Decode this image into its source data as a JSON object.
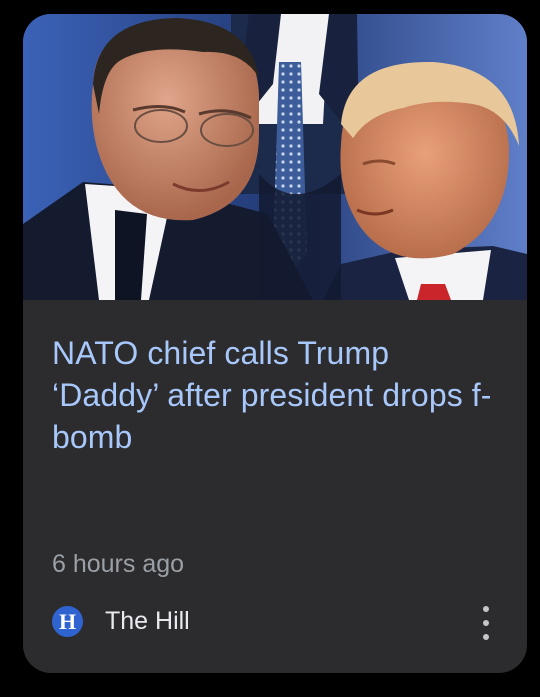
{
  "article": {
    "headline": "NATO chief calls Trump ‘Daddy’ after president drops f-bomb",
    "time_ago": "6 hours ago",
    "source": {
      "logo_letter": "H",
      "name": "The Hill",
      "logo_color": "#2f63d0"
    },
    "image_icon": "news-photo",
    "menu_icon": "more-vert-icon"
  },
  "colors": {
    "background": "#000000",
    "card": "#2c2c2e",
    "headline": "#a8c7fa",
    "meta": "#9aa0a6"
  }
}
